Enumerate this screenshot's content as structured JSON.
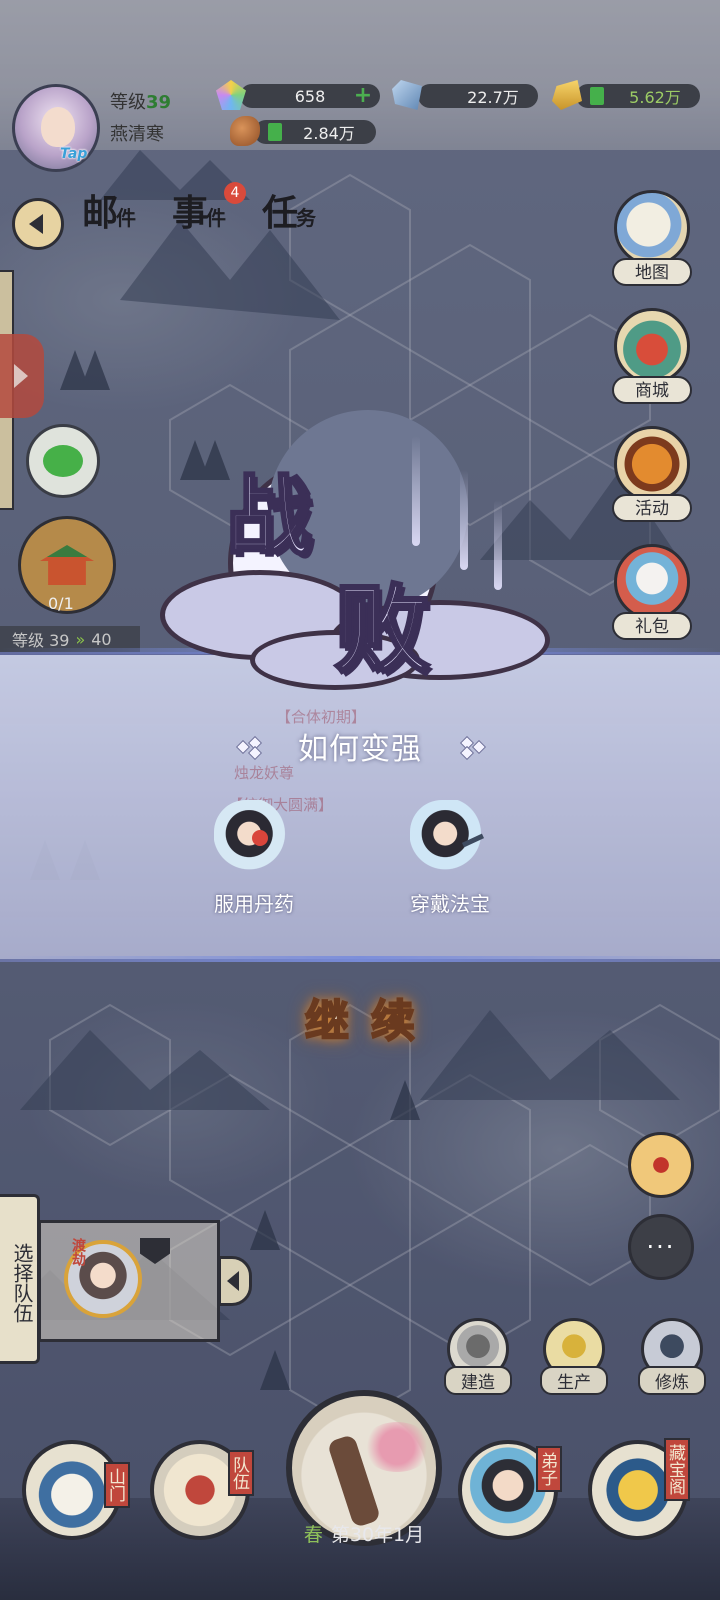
{
  "player": {
    "level_label": "等级",
    "level": "39",
    "name": "燕清寒",
    "tap_label": "Tap"
  },
  "resources": {
    "spirit_stone": "658",
    "ore": "22.7万",
    "gold": "5.62万",
    "food": "2.84万",
    "plus": "+"
  },
  "top_menu": {
    "mail": {
      "big": "邮",
      "small": "件"
    },
    "events": {
      "big": "事",
      "small": "件",
      "badge": "4"
    },
    "tasks": {
      "big": "任",
      "small": "务"
    }
  },
  "left_panel": {
    "temple_count": "0/1",
    "level_from": "等级 39",
    "level_to": "40"
  },
  "side_menu": {
    "map": "地图",
    "shop": "商城",
    "event": "活动",
    "gift": "礼包"
  },
  "defeat": {
    "char_1": "战",
    "char_2": "败",
    "howto_title": "如何变强",
    "tip_1": "服用丹药",
    "tip_2": "穿戴法宝",
    "continue": "继续"
  },
  "map_ghost": {
    "line_1": "【合体初期】",
    "line_2": "烛龙妖尊",
    "line_3": "【统御大圆满】"
  },
  "team": {
    "select_label": "选择队伍",
    "hero_tag": "渡劫"
  },
  "functions": {
    "build": "建造",
    "produce": "生产",
    "train": "修炼",
    "chat_dots": "···"
  },
  "bottom_nav": {
    "gate": "山门",
    "team": "队伍",
    "disciple": "弟子",
    "vault": "藏宝阁"
  },
  "season": {
    "season": "春",
    "date": "第30年1月"
  }
}
